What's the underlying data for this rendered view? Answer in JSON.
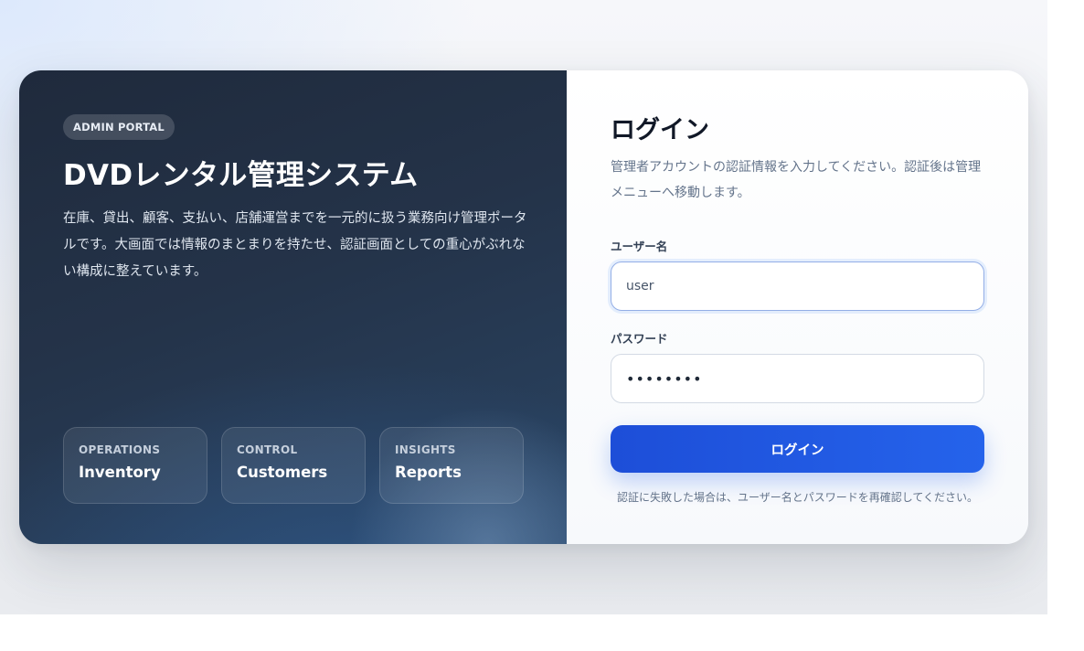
{
  "hero": {
    "badge": "ADMIN PORTAL",
    "title": "DVDレンタル管理システム",
    "description": "在庫、貸出、顧客、支払い、店舗運営までを一元的に扱う業務向け管理ポータルです。大画面では情報のまとまりを持たせ、認証画面としての重心がぶれない構成に整えています。",
    "tiles": [
      {
        "kicker": "OPERATIONS",
        "label": "Inventory"
      },
      {
        "kicker": "CONTROL",
        "label": "Customers"
      },
      {
        "kicker": "INSIGHTS",
        "label": "Reports"
      }
    ]
  },
  "login": {
    "title": "ログイン",
    "description": "管理者アカウントの認証情報を入力してください。認証後は管理メニューへ移動します。",
    "username_label": "ユーザー名",
    "username_value": "user",
    "password_label": "パスワード",
    "password_value": "••••••••",
    "submit_label": "ログイン",
    "hint": "認証に失敗した場合は、ユーザー名とパスワードを再確認してください。"
  },
  "colors": {
    "accent": "#2563eb",
    "hero_dark": "#1f2a3c",
    "focus_border": "#93aee6"
  }
}
